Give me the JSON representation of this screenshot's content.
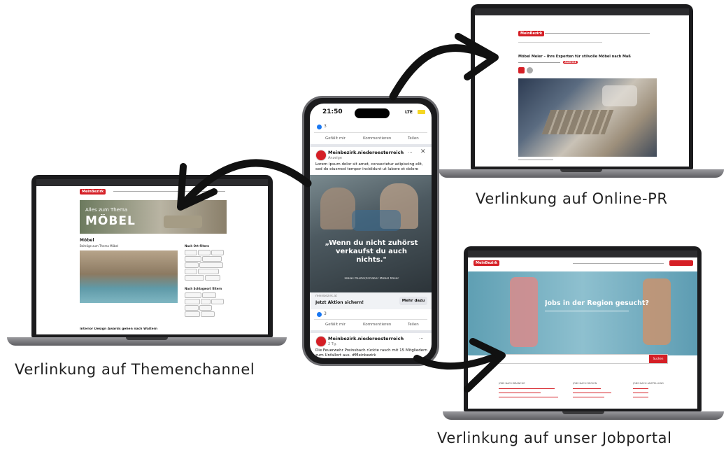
{
  "captions": {
    "online_pr": "Verlinkung auf Online-PR",
    "themenchannel": "Verlinkung auf Themenchannel",
    "jobportal": "Verlinkung auf unser Jobportal"
  },
  "phone": {
    "time": "21:50",
    "signal": "LTE",
    "reaction_count_top": "3",
    "actions": [
      "Gefällt mir",
      "Kommentieren",
      "Teilen"
    ],
    "post1": {
      "page_name": "Meinbezirk.niederoesterreich",
      "meta": "Anzeige",
      "text": "Lorem ipsum dolor sit amet, consectetur adipiscing elit, sed do eiusmod tempor incididunt ut labore et dolore magna",
      "quote": "„Wenn du nicht zuhörst verkaufst du auch nichts.\"",
      "quote_author": "Tobias Muster/Inhaber Möbel Meier",
      "link_domain": "meinbezirk.at",
      "link_title": "Jetzt Aktion sichern!",
      "cta": "Mehr dazu",
      "reaction_count": "3"
    },
    "post2": {
      "page_name": "Meinbezirk.niederoesterreich",
      "meta": "2 Tg.",
      "text": "Die Feuerwehr Preinsbach rückte rasch mit 15 Mitgliedern zum Unfallort aus. #Meinbezirk"
    }
  },
  "laptop_left": {
    "banner_small": "Alles zum Thema",
    "banner_big": "MÖBEL",
    "section_title": "Möbel",
    "sub_title": "Beiträge zum Thema Möbel",
    "article_title": "Interior Design Awards gehen nach Waltern",
    "sidebar_title": "Nach Ort filtern",
    "sidebar_title2": "Nach Schlagwort filtern"
  },
  "laptop_tr": {
    "brand": "MeinBezirk",
    "headline": "Möbel Meier – Ihre Experten für stilvolle Möbel nach Maß",
    "badge": "ANZEIGE"
  },
  "laptop_br": {
    "brand": "MeinBezirk",
    "hero": "Jobs in der Region gesucht?",
    "search_button": "Suchen",
    "cols": [
      "JOBS NACH BRANCHE",
      "JOBS NACH REGION",
      "JOBS NACH ANSTELLUNG"
    ]
  },
  "colors": {
    "brand_red": "#d51f26",
    "laptop_frame": "#1b1b1d",
    "facebook_blue": "#1877f2"
  }
}
